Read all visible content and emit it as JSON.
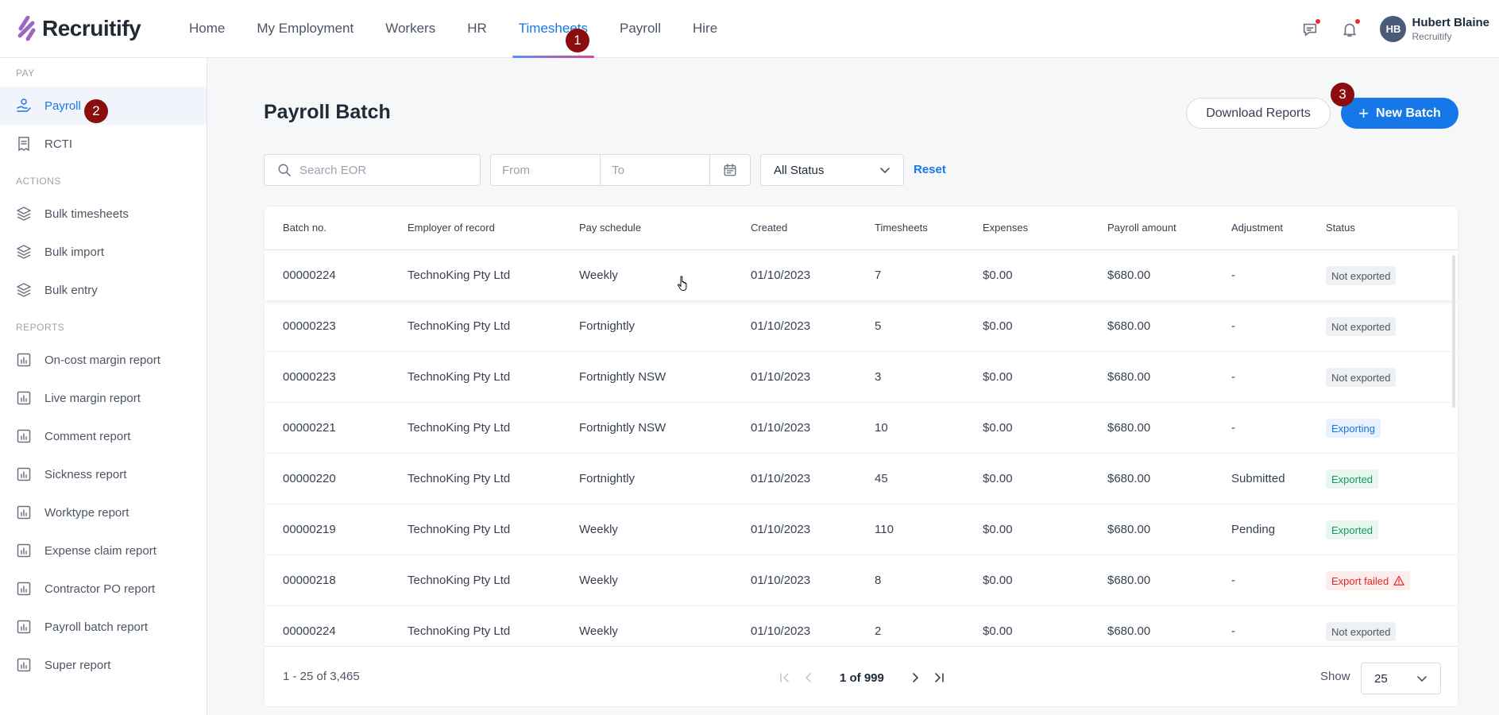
{
  "brand": {
    "name": "Recruitify"
  },
  "nav": [
    {
      "label": "Home",
      "active": false
    },
    {
      "label": "My Employment",
      "active": false
    },
    {
      "label": "Workers",
      "active": false
    },
    {
      "label": "HR",
      "active": false
    },
    {
      "label": "Timesheets",
      "active": true
    },
    {
      "label": "Payroll",
      "active": false
    },
    {
      "label": "Hire",
      "active": false
    }
  ],
  "markers": {
    "m1": "1",
    "m2": "2",
    "m3": "3"
  },
  "header_icons": [
    "message-icon",
    "bell-icon"
  ],
  "user": {
    "initials": "HB",
    "name": "Hubert Blaine",
    "org": "Recruitify"
  },
  "sidebar": {
    "pay_title": "PAY",
    "pay": [
      {
        "label": "Payroll",
        "icon": "payroll-icon",
        "active": true
      },
      {
        "label": "RCTI",
        "icon": "receipt-icon",
        "active": false
      }
    ],
    "actions_title": "ACTIONS",
    "actions": [
      {
        "label": "Bulk timesheets",
        "icon": "layers-icon"
      },
      {
        "label": "Bulk import",
        "icon": "layers-icon"
      },
      {
        "label": "Bulk entry",
        "icon": "layers-icon"
      }
    ],
    "reports_title": "REPORTS",
    "reports": [
      {
        "label": "On-cost margin report",
        "icon": "report-icon"
      },
      {
        "label": "Live margin report",
        "icon": "report-icon"
      },
      {
        "label": "Comment report",
        "icon": "report-icon"
      },
      {
        "label": "Sickness report",
        "icon": "report-icon"
      },
      {
        "label": "Worktype report",
        "icon": "report-icon"
      },
      {
        "label": "Expense claim report",
        "icon": "report-icon"
      },
      {
        "label": "Contractor PO report",
        "icon": "report-icon"
      },
      {
        "label": "Payroll batch report",
        "icon": "report-icon"
      },
      {
        "label": "Super report",
        "icon": "report-icon"
      }
    ]
  },
  "page": {
    "title": "Payroll Batch",
    "download_label": "Download Reports",
    "new_batch_label": "New Batch"
  },
  "filters": {
    "search_placeholder": "Search EOR",
    "from_placeholder": "From",
    "to_placeholder": "To",
    "status_value": "All Status",
    "reset_label": "Reset"
  },
  "table": {
    "columns": [
      "Batch no.",
      "Employer of record",
      "Pay schedule",
      "Created",
      "Timesheets",
      "Expenses",
      "Payroll amount",
      "Adjustment",
      "Status"
    ],
    "rows": [
      {
        "batch": "00000224",
        "employer": "TechnoKing Pty Ltd",
        "schedule": "Weekly",
        "created": "01/10/2023",
        "timesheets": "7",
        "expenses": "$0.00",
        "amount": "$680.00",
        "adjustment": "-",
        "status": "Not exported",
        "status_type": "neutral"
      },
      {
        "batch": "00000223",
        "employer": "TechnoKing Pty Ltd",
        "schedule": "Fortnightly",
        "created": "01/10/2023",
        "timesheets": "5",
        "expenses": "$0.00",
        "amount": "$680.00",
        "adjustment": "-",
        "status": "Not exported",
        "status_type": "neutral"
      },
      {
        "batch": "00000223",
        "employer": "TechnoKing Pty Ltd",
        "schedule": "Fortnightly NSW",
        "created": "01/10/2023",
        "timesheets": "3",
        "expenses": "$0.00",
        "amount": "$680.00",
        "adjustment": "-",
        "status": "Not exported",
        "status_type": "neutral"
      },
      {
        "batch": "00000221",
        "employer": "TechnoKing Pty Ltd",
        "schedule": "Fortnightly NSW",
        "created": "01/10/2023",
        "timesheets": "10",
        "expenses": "$0.00",
        "amount": "$680.00",
        "adjustment": "-",
        "status": "Exporting",
        "status_type": "info"
      },
      {
        "batch": "00000220",
        "employer": "TechnoKing Pty Ltd",
        "schedule": "Fortnightly",
        "created": "01/10/2023",
        "timesheets": "45",
        "expenses": "$0.00",
        "amount": "$680.00",
        "adjustment": "Submitted",
        "status": "Exported",
        "status_type": "success"
      },
      {
        "batch": "00000219",
        "employer": "TechnoKing Pty Ltd",
        "schedule": "Weekly",
        "created": "01/10/2023",
        "timesheets": "110",
        "expenses": "$0.00",
        "amount": "$680.00",
        "adjustment": "Pending",
        "status": "Exported",
        "status_type": "success"
      },
      {
        "batch": "00000218",
        "employer": "TechnoKing Pty Ltd",
        "schedule": "Weekly",
        "created": "01/10/2023",
        "timesheets": "8",
        "expenses": "$0.00",
        "amount": "$680.00",
        "adjustment": "-",
        "status": "Export failed",
        "status_type": "error"
      },
      {
        "batch": "00000224",
        "employer": "TechnoKing Pty Ltd",
        "schedule": "Weekly",
        "created": "01/10/2023",
        "timesheets": "2",
        "expenses": "$0.00",
        "amount": "$680.00",
        "adjustment": "-",
        "status": "Not exported",
        "status_type": "neutral"
      }
    ]
  },
  "pagination": {
    "range": "1 - 25 of 3,465",
    "page": "1 of 999",
    "show_label": "Show",
    "page_size": "25"
  },
  "colors": {
    "accent": "#1677e8",
    "marker": "#8b0d0d",
    "error": "#e02a2a",
    "success": "#159a5c"
  }
}
